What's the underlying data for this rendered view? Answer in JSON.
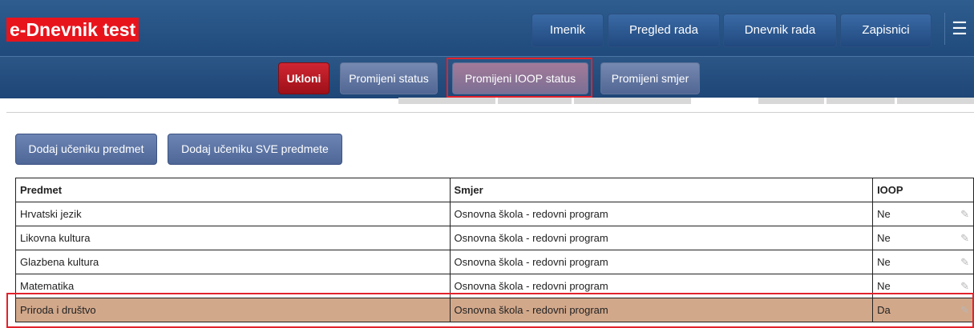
{
  "app": {
    "title": "e-Dnevnik test"
  },
  "nav": {
    "items": [
      "Imenik",
      "Pregled rada",
      "Dnevnik rada",
      "Zapisnici"
    ],
    "menu_icon": "hamburger-icon"
  },
  "actions": {
    "remove": "Ukloni",
    "change_status": "Promijeni status",
    "change_ioop_status": "Promijeni IOOP status",
    "change_direction": "Promijeni smjer"
  },
  "buttons": {
    "add_subject": "Dodaj učeniku predmet",
    "add_all_subjects": "Dodaj učeniku SVE predmete"
  },
  "table": {
    "headers": [
      "Predmet",
      "Smjer",
      "IOOP"
    ],
    "rows": [
      {
        "predmet": "Hrvatski jezik",
        "smjer": "Osnovna škola - redovni program",
        "ioop": "Ne"
      },
      {
        "predmet": "Likovna kultura",
        "smjer": "Osnovna škola - redovni program",
        "ioop": "Ne"
      },
      {
        "predmet": "Glazbena kultura",
        "smjer": "Osnovna škola - redovni program",
        "ioop": "Ne"
      },
      {
        "predmet": "Matematika",
        "smjer": "Osnovna škola - redovni program",
        "ioop": "Ne"
      },
      {
        "predmet": "Priroda i društvo",
        "smjer": "Osnovna škola - redovni program",
        "ioop": "Da"
      }
    ]
  },
  "colors": {
    "brand_red": "#e8141c",
    "highlight_border": "#e2222b",
    "selected_row": "#d2a88b"
  }
}
